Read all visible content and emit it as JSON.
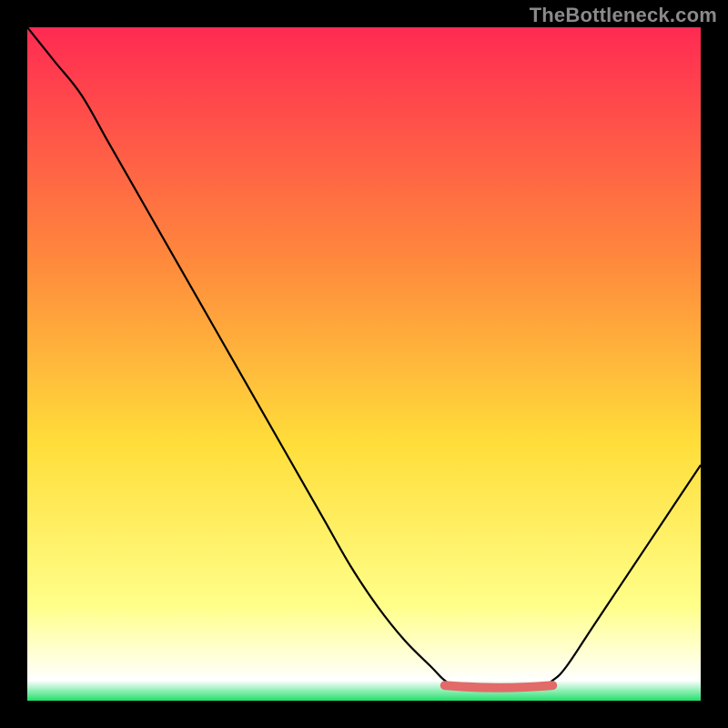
{
  "watermark": "TheBottleneck.com",
  "colors": {
    "bg": "#000000",
    "watermark": "#8a8a8a",
    "curve": "#000000",
    "accent_flat": "#e26a69",
    "grad_top": "#ff2a52",
    "grad_mid1": "#ff8a3c",
    "grad_mid2": "#ffde3a",
    "grad_low": "#ffff8a",
    "grad_base": "#22e06a"
  },
  "chart_data": {
    "type": "line",
    "title": "",
    "xlabel": "",
    "ylabel": "",
    "xlim": [
      0,
      100
    ],
    "ylim": [
      0,
      100
    ],
    "x": [
      0,
      4,
      8,
      12,
      16,
      20,
      24,
      28,
      32,
      36,
      40,
      44,
      48,
      52,
      56,
      60,
      62,
      64,
      68,
      72,
      76,
      78,
      80,
      84,
      88,
      92,
      96,
      100
    ],
    "values": [
      100,
      95,
      90,
      83,
      76,
      69,
      62,
      55,
      48,
      41,
      34,
      27,
      20,
      14,
      9,
      5,
      3,
      2,
      2,
      2,
      2,
      3,
      5,
      11,
      17,
      23,
      29,
      35
    ],
    "flat_segment": {
      "x0": 62,
      "x1": 78,
      "y": 2
    },
    "gradient_stops": [
      {
        "pos": 0.0,
        "color": "#ff2a52"
      },
      {
        "pos": 0.35,
        "color": "#ff8a3c"
      },
      {
        "pos": 0.62,
        "color": "#ffde3a"
      },
      {
        "pos": 0.86,
        "color": "#ffff8a"
      },
      {
        "pos": 0.97,
        "color": "#ffffff"
      },
      {
        "pos": 1.0,
        "color": "#22e06a"
      }
    ]
  }
}
